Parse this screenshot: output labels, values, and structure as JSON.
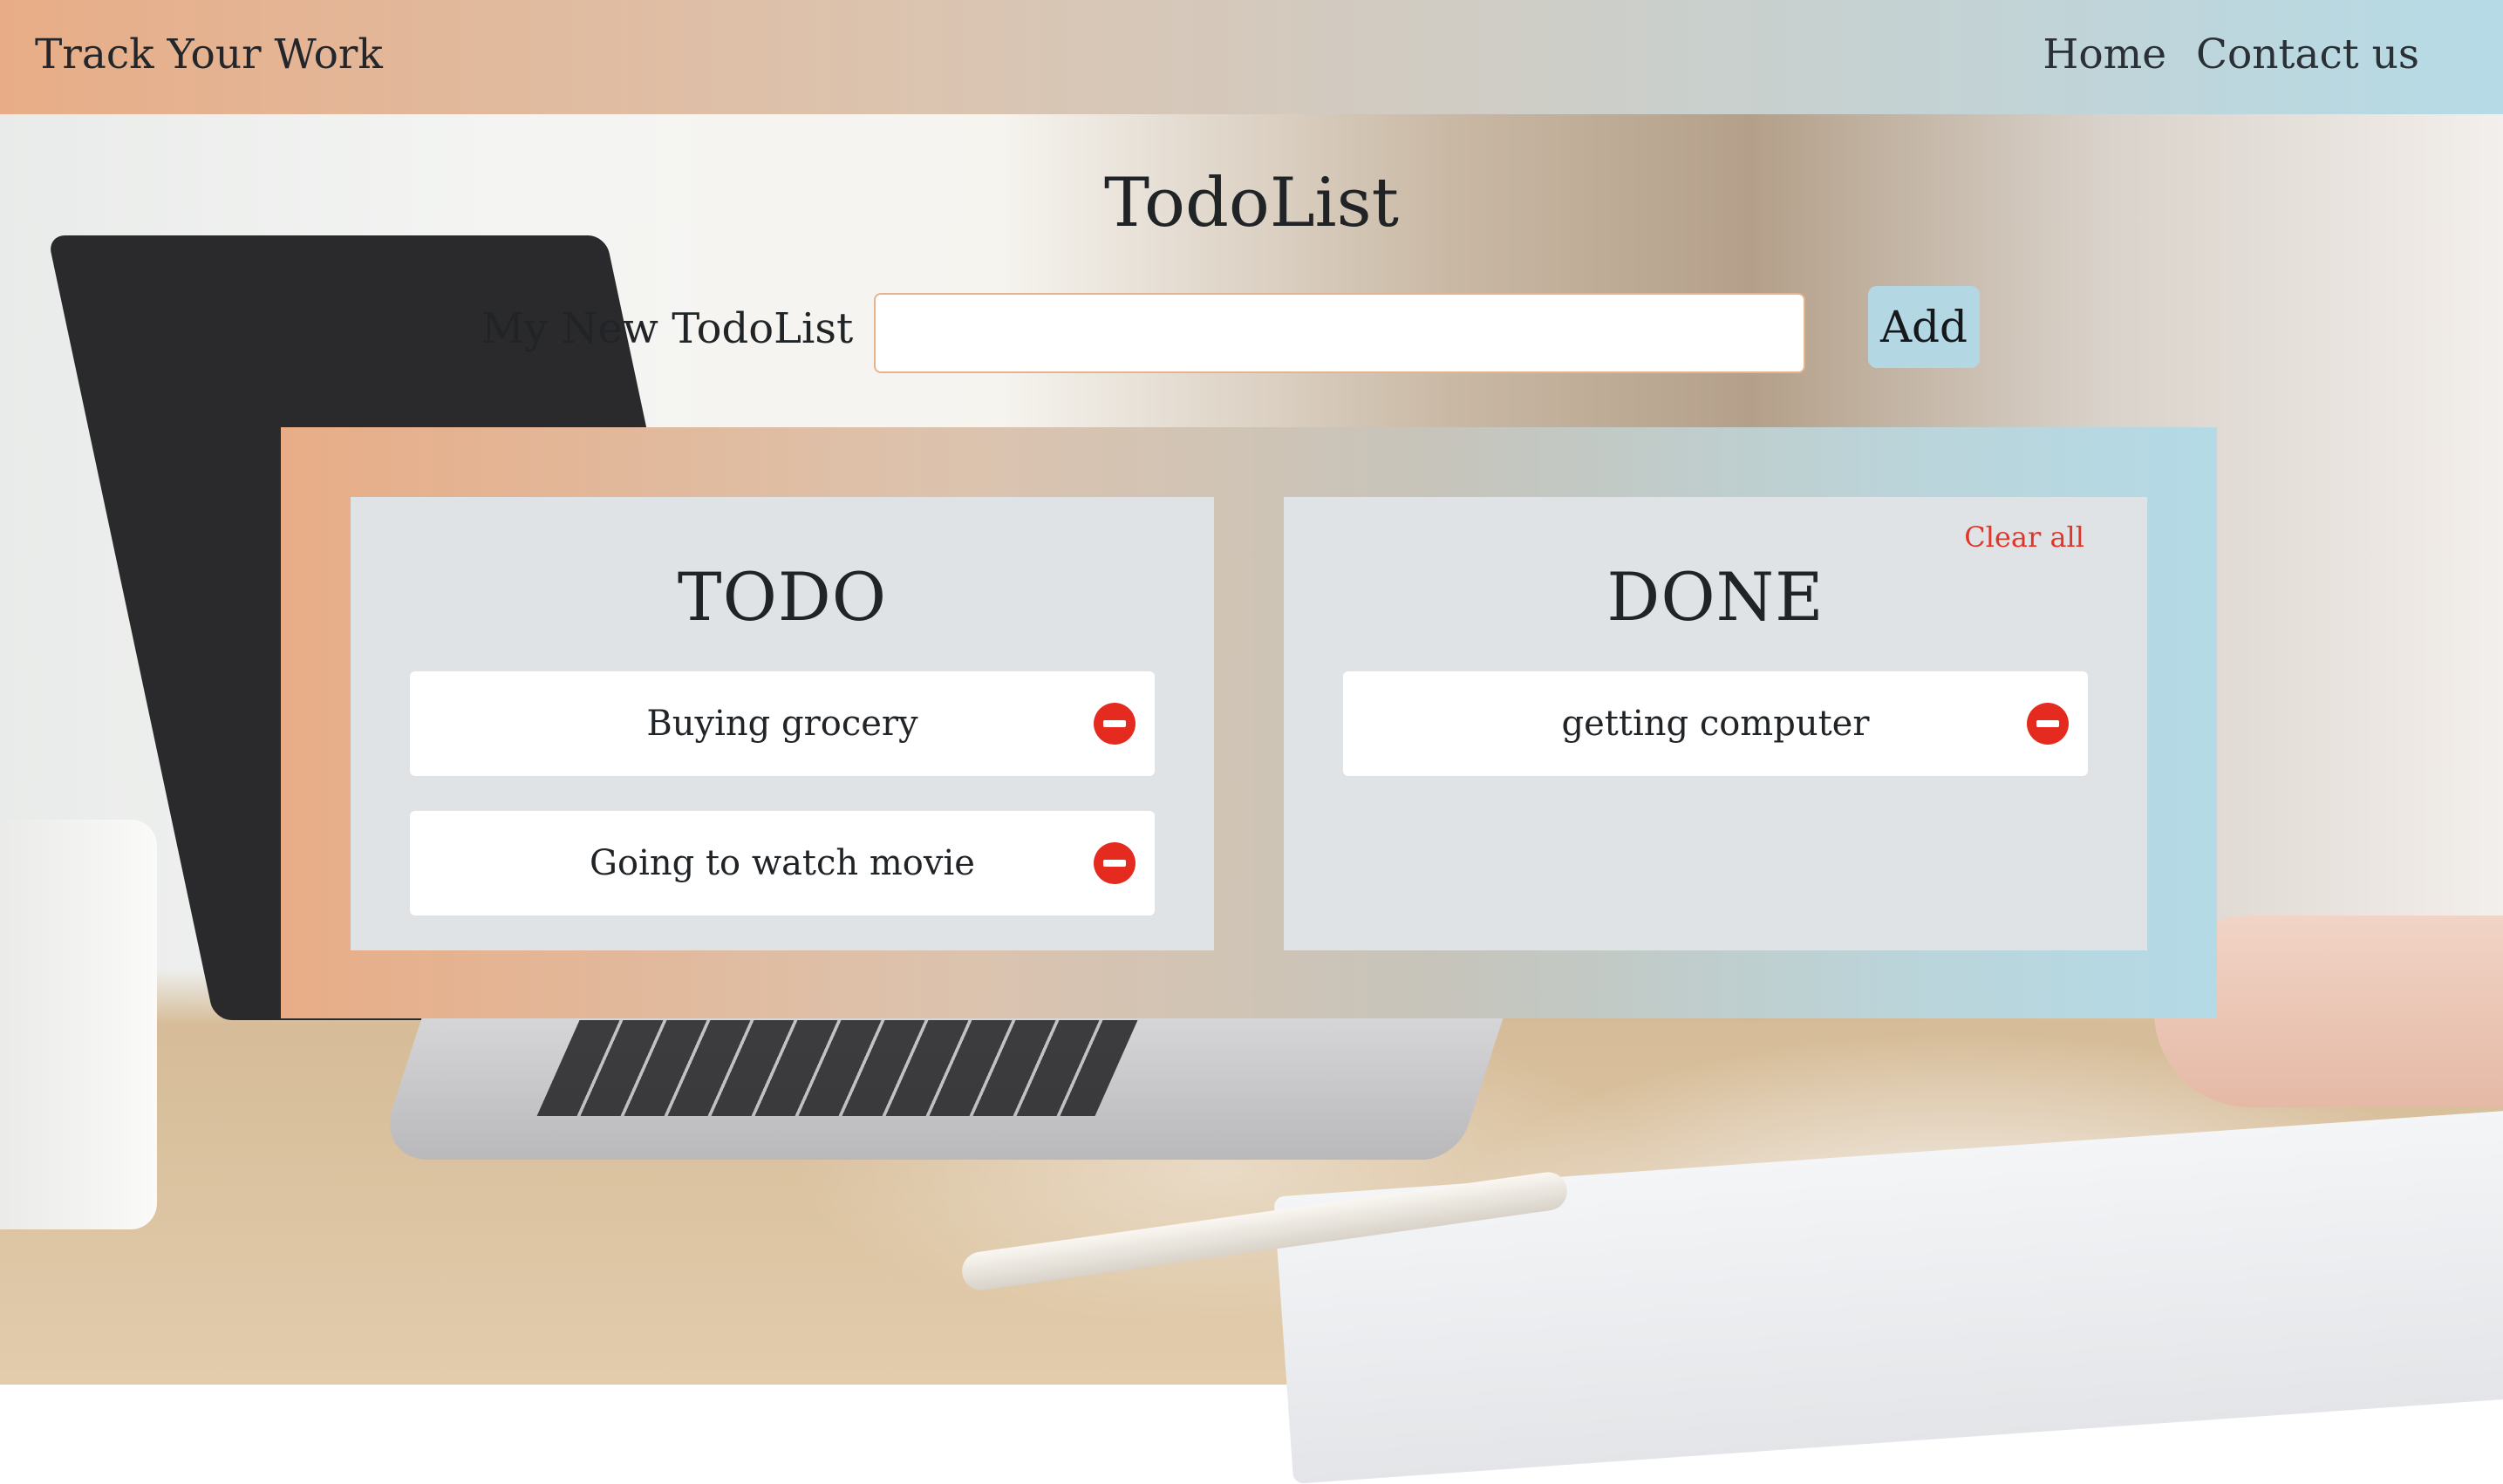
{
  "header": {
    "brand": "Track Your Work",
    "nav": [
      "Home",
      "Contact us"
    ]
  },
  "main": {
    "title": "TodoList",
    "new_label": "My New TodoList",
    "input_value": "",
    "add_label": "Add"
  },
  "todo": {
    "title": "TODO",
    "items": [
      "Buying grocery",
      "Going to watch movie"
    ]
  },
  "done": {
    "title": "DONE",
    "clear_label": "Clear all",
    "items": [
      "getting computer"
    ]
  },
  "icons": {
    "remove": "minus-circle-icon"
  },
  "colors": {
    "gradient_start": "#e8ad87",
    "gradient_end": "#b4dae6",
    "add_button": "#b3d7e3",
    "danger": "#e52a20",
    "panel": "#e0e3e6"
  }
}
